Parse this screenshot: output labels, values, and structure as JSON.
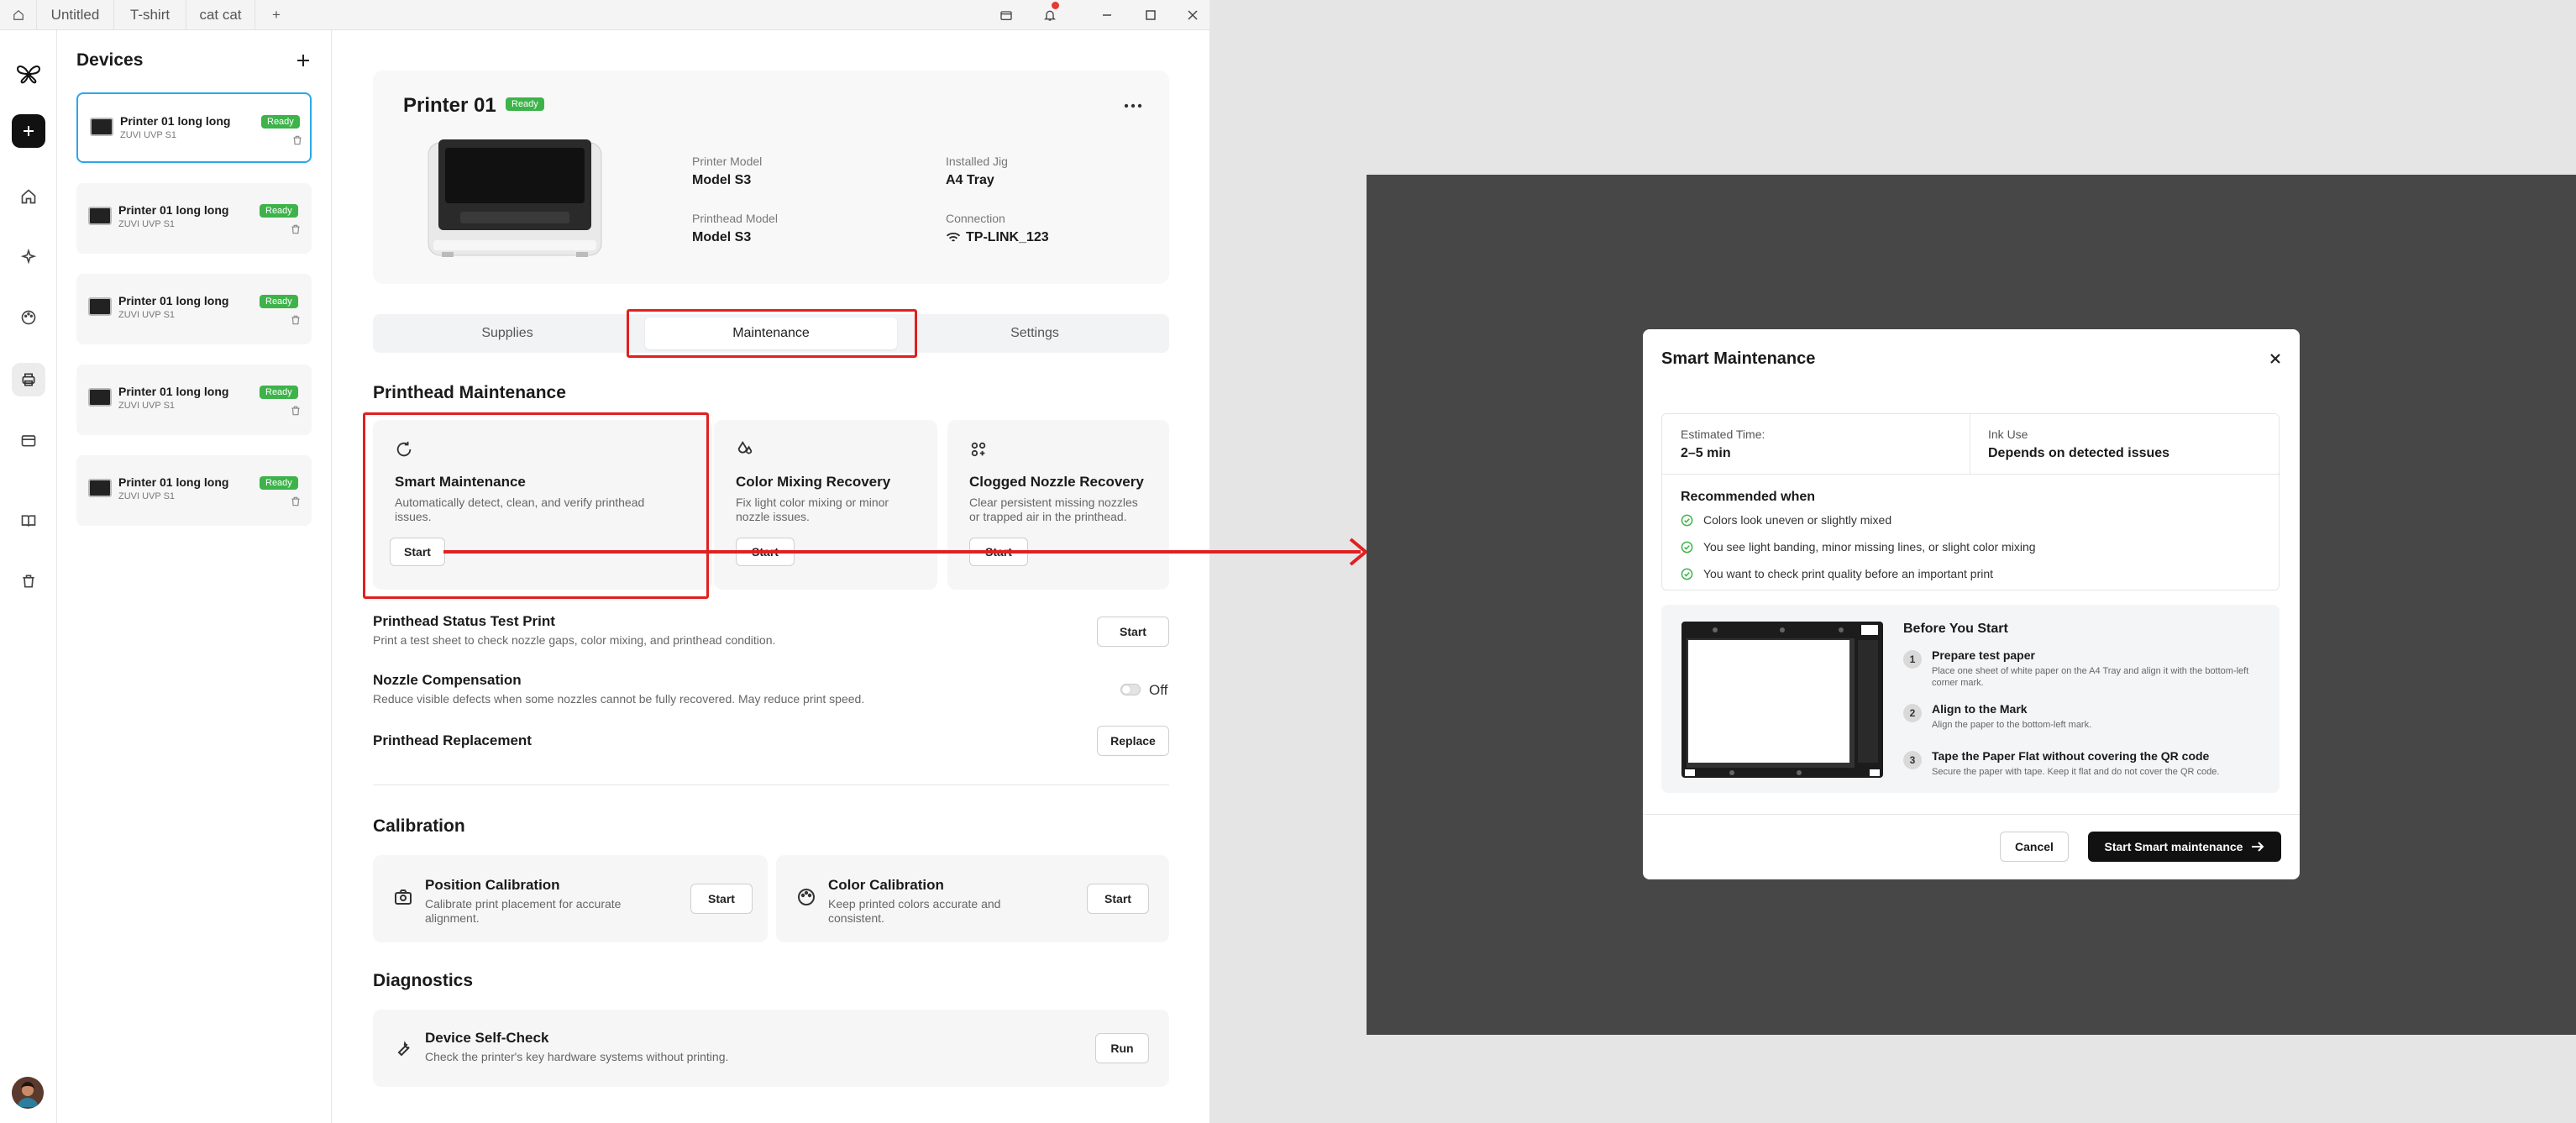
{
  "titlebar": {
    "tabs": [
      "Untitled",
      "T-shirt",
      "cat cat"
    ],
    "new_tab": "+"
  },
  "devices": {
    "title": "Devices",
    "items": [
      {
        "name": "Printer 01 long long",
        "model": "ZUVI UVP S1",
        "status": "Ready"
      },
      {
        "name": "Printer 01 long long",
        "model": "ZUVI UVP S1",
        "status": "Ready"
      },
      {
        "name": "Printer 01 long long",
        "model": "ZUVI UVP S1",
        "status": "Ready"
      },
      {
        "name": "Printer 01 long long",
        "model": "ZUVI UVP S1",
        "status": "Ready"
      },
      {
        "name": "Printer 01 long long",
        "model": "ZUVI UVP S1",
        "status": "Ready"
      }
    ]
  },
  "printer": {
    "title": "Printer 01",
    "status": "Ready",
    "model_label": "Printer Model",
    "model_value": "Model S3",
    "jig_label": "Installed Jig",
    "jig_value": "A4 Tray",
    "head_label": "Printhead Model",
    "head_value": "Model S3",
    "conn_label": "Connection",
    "conn_value": "TP-LINK_123"
  },
  "tabs": [
    "Supplies",
    "Maintenance",
    "Settings"
  ],
  "printhead": {
    "title": "Printhead Maintenance",
    "cards": [
      {
        "title": "Smart Maintenance",
        "desc1": "Automatically detect, clean, and verify printhead",
        "desc2": "issues.",
        "button": "Start"
      },
      {
        "title": "Color Mixing Recovery",
        "desc1": "Fix light color mixing or minor",
        "desc2": "nozzle issues.",
        "button": "Start"
      },
      {
        "title": "Clogged Nozzle Recovery",
        "desc1": "Clear persistent missing nozzles",
        "desc2": "or trapped air in the printhead.",
        "button": "Start"
      }
    ],
    "test_title": "Printhead Status Test Print",
    "test_desc": "Print a test sheet to check nozzle gaps, color mixing, and printhead condition.",
    "test_button": "Start",
    "comp_title": "Nozzle Compensation",
    "comp_desc": "Reduce visible defects when some nozzles cannot be fully recovered. May reduce print speed.",
    "comp_state": "Off",
    "replace_title": "Printhead Replacement",
    "replace_button": "Replace"
  },
  "calibration": {
    "title": "Calibration",
    "cards": [
      {
        "title": "Position Calibration",
        "desc1": "Calibrate print placement for accurate",
        "desc2": "alignment.",
        "button": "Start"
      },
      {
        "title": "Color Calibration",
        "desc1": "Keep printed colors accurate and",
        "desc2": "consistent.",
        "button": "Start"
      }
    ]
  },
  "diagnostics": {
    "title": "Diagnostics",
    "card_title": "Device Self-Check",
    "card_desc": "Check the printer's key hardware systems without printing.",
    "button": "Run"
  },
  "modal": {
    "title": "Smart Maintenance",
    "time_label": "Estimated Time:",
    "time_value": "2–5 min",
    "ink_label": "Ink Use",
    "ink_value": "Depends on detected issues",
    "rec_title": "Recommended when",
    "rec_items": [
      "Colors look uneven or slightly mixed",
      "You see light banding, minor missing lines, or slight color mixing",
      "You want to check print quality before an important print"
    ],
    "before_title": "Before You Start",
    "steps": [
      {
        "num": "1",
        "title": "Prepare test paper",
        "desc": "Place one sheet of white paper on the A4 Tray and align it with the bottom-left corner mark."
      },
      {
        "num": "2",
        "title": "Align to the Mark",
        "desc": "Align the paper to the bottom-left mark."
      },
      {
        "num": "3",
        "title": "Tape the Paper Flat without covering the QR code",
        "desc": "Secure the paper with tape. Keep it flat and do not cover the QR code."
      }
    ],
    "cancel": "Cancel",
    "start": "Start Smart maintenance"
  }
}
